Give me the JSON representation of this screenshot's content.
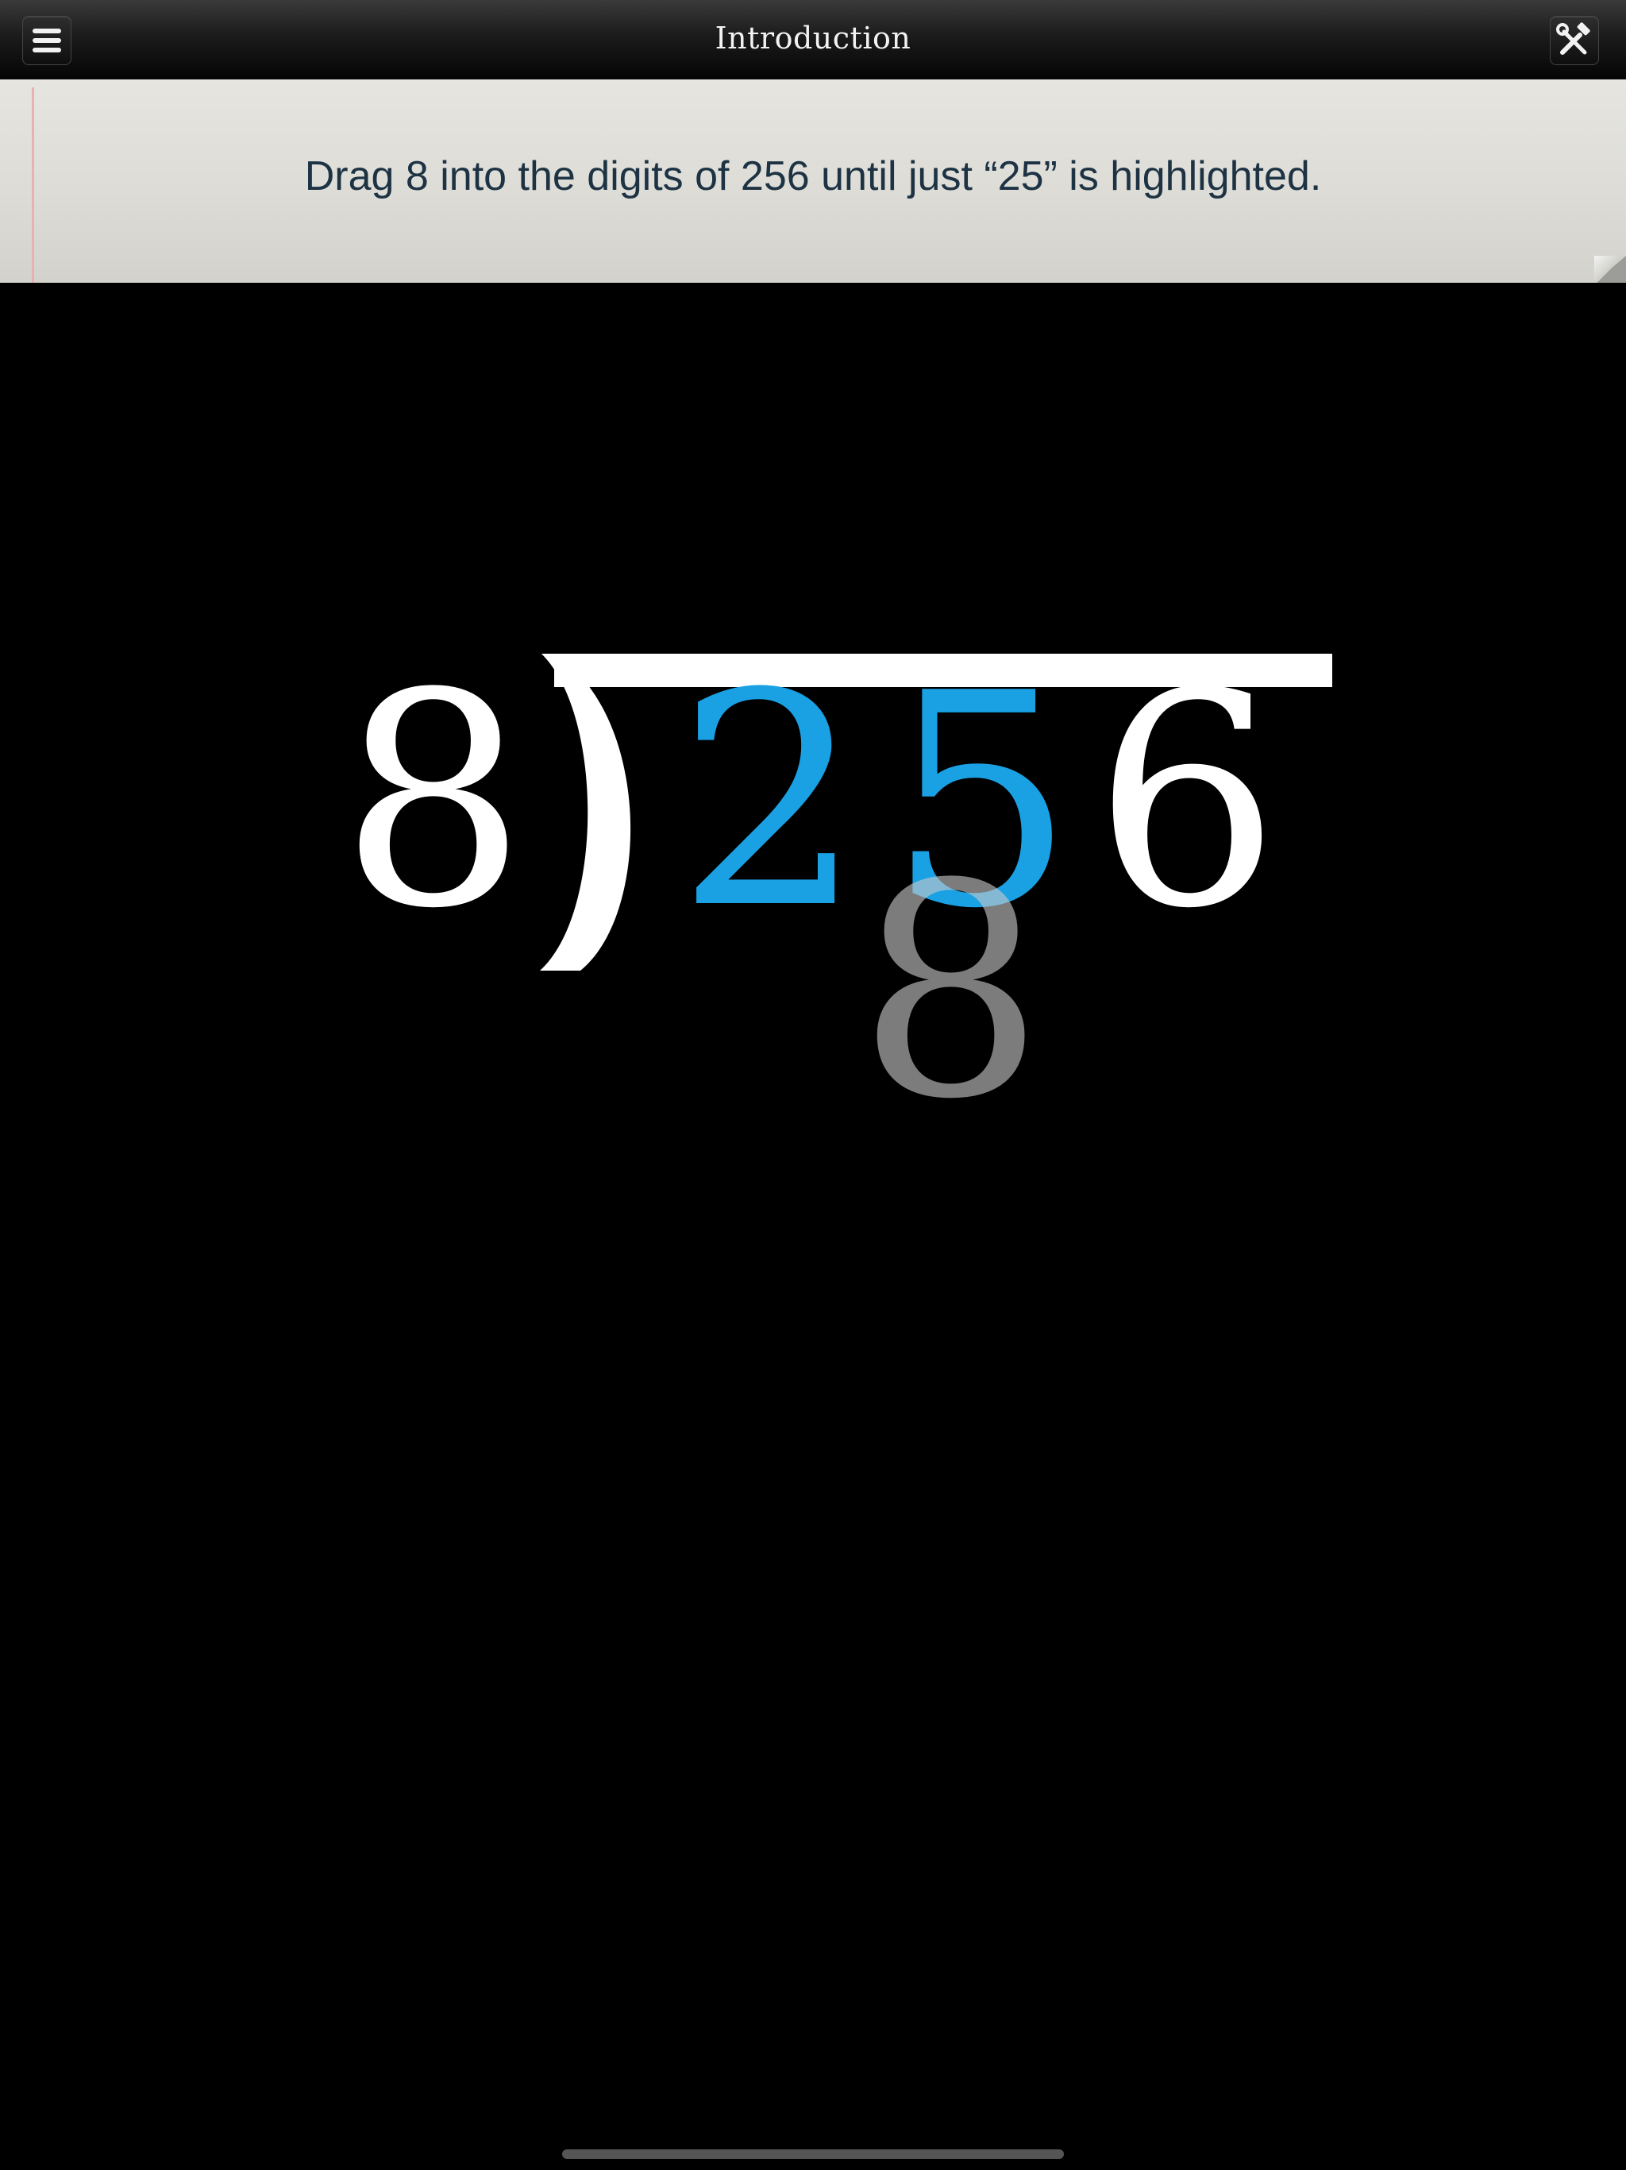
{
  "navbar": {
    "title": "Introduction",
    "menu_icon": "hamburger-menu-icon",
    "tools_icon": "hammer-wrench-tools-icon"
  },
  "instruction": {
    "text": "Drag 8 into the digits of 256 until just “25” is highlighted."
  },
  "division": {
    "divisor": "8",
    "dividend_digits": [
      "2",
      "5",
      "6"
    ],
    "highlighted_digits": [
      "2",
      "5"
    ],
    "dragged_digit": "8"
  },
  "colors": {
    "highlight": "#1aa1e4",
    "digit": "#ffffff",
    "dragged": "#8a8a8a",
    "background": "#000000",
    "instruction_text": "#1d3344"
  }
}
